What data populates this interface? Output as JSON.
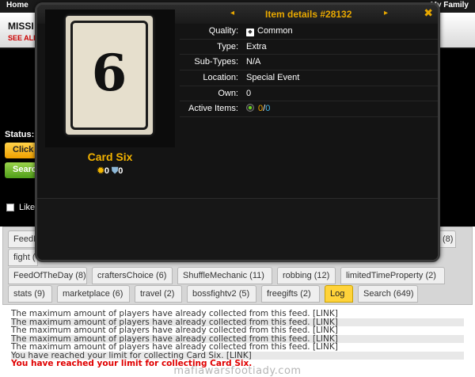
{
  "page": {
    "nav_home": "Home",
    "nav_family": "My Family",
    "mission_title": "MISSI",
    "see_all": "SEE ALL",
    "status_label": "Status:",
    "click_button": "Click",
    "search_button": "Searc",
    "like_label": "Like"
  },
  "modal": {
    "title": "Item details #28132",
    "prev_symbol": "◂",
    "next_symbol": "▸",
    "close_symbol": "✖",
    "card_number": "6",
    "item_name": "Card Six",
    "attack_icon": "✹",
    "attack": "0",
    "defense_icon": "⛊",
    "defense": "0",
    "rarity_icon_glyph": "◆",
    "details": [
      {
        "label": "Quality:",
        "value": "Common"
      },
      {
        "label": "Type:",
        "value": "Extra"
      },
      {
        "label": "Sub-Types:",
        "value": "N/A"
      },
      {
        "label": "Location:",
        "value": "Special Event"
      },
      {
        "label": "Own:",
        "value": "0"
      },
      {
        "label": "Active Items:",
        "value": ""
      }
    ],
    "active_a": "0",
    "active_sep": "/",
    "active_b": "0"
  },
  "tabs": [
    {
      "label": "FeedL"
    },
    {
      "label": "(8)"
    },
    {
      "label": "fight ("
    },
    {
      "label": "FeedOfTheDay (8)"
    },
    {
      "label": "craftersChoice (6)"
    },
    {
      "label": "ShuffleMechanic (11)"
    },
    {
      "label": "robbing (12)"
    },
    {
      "label": "limitedTimeProperty (2)"
    },
    {
      "label": "stats (9)"
    },
    {
      "label": "marketplace (6)"
    },
    {
      "label": "travel (2)"
    },
    {
      "label": "bossfightv2 (5)"
    },
    {
      "label": "freegifts (2)"
    },
    {
      "label": "Log"
    },
    {
      "label": "Search (649)"
    }
  ],
  "log": [
    "The maximum amount of players have already collected from this feed. [LINK]",
    "The maximum amount of players have already collected from this feed. [LINK]",
    "The maximum amount of players have already collected from this feed. [LINK]",
    "The maximum amount of players have already collected from this feed. [LINK]",
    "The maximum amount of players have already collected from this feed. [LINK]",
    "You have reached your limit for collecting Card Six. [LINK]",
    "You have reached your limit for collecting Card Six."
  ],
  "watermark": "mafiawarsfootiady.com"
}
